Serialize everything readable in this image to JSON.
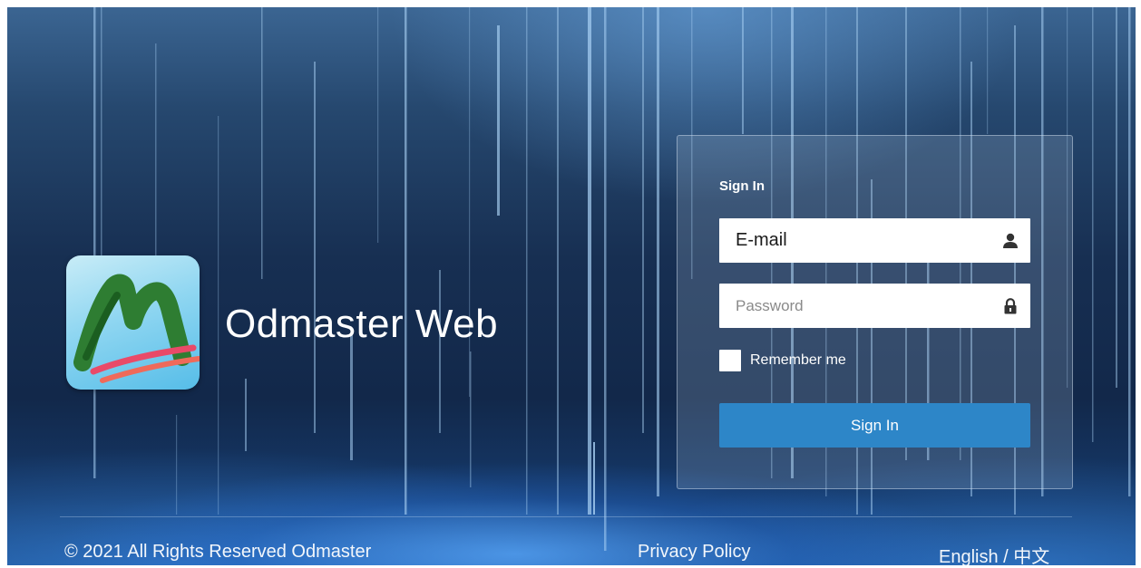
{
  "brand": {
    "name": "Odmaster Web",
    "logo_icon": "odmaster-logo-icon"
  },
  "login": {
    "title": "Sign In",
    "email_value": "E-mail",
    "email_icon": "user-icon",
    "password_placeholder": "Password",
    "password_icon": "lock-icon",
    "remember_label": "Remember me",
    "remember_checked": false,
    "submit_label": "Sign In"
  },
  "footer": {
    "copyright": "© 2021 All Rights Reserved Odmaster",
    "privacy": "Privacy Policy",
    "language": "English / 中文"
  },
  "colors": {
    "button": "#2d86c8",
    "background_dark": "#12284a",
    "background_glow": "#5aa8ff"
  }
}
